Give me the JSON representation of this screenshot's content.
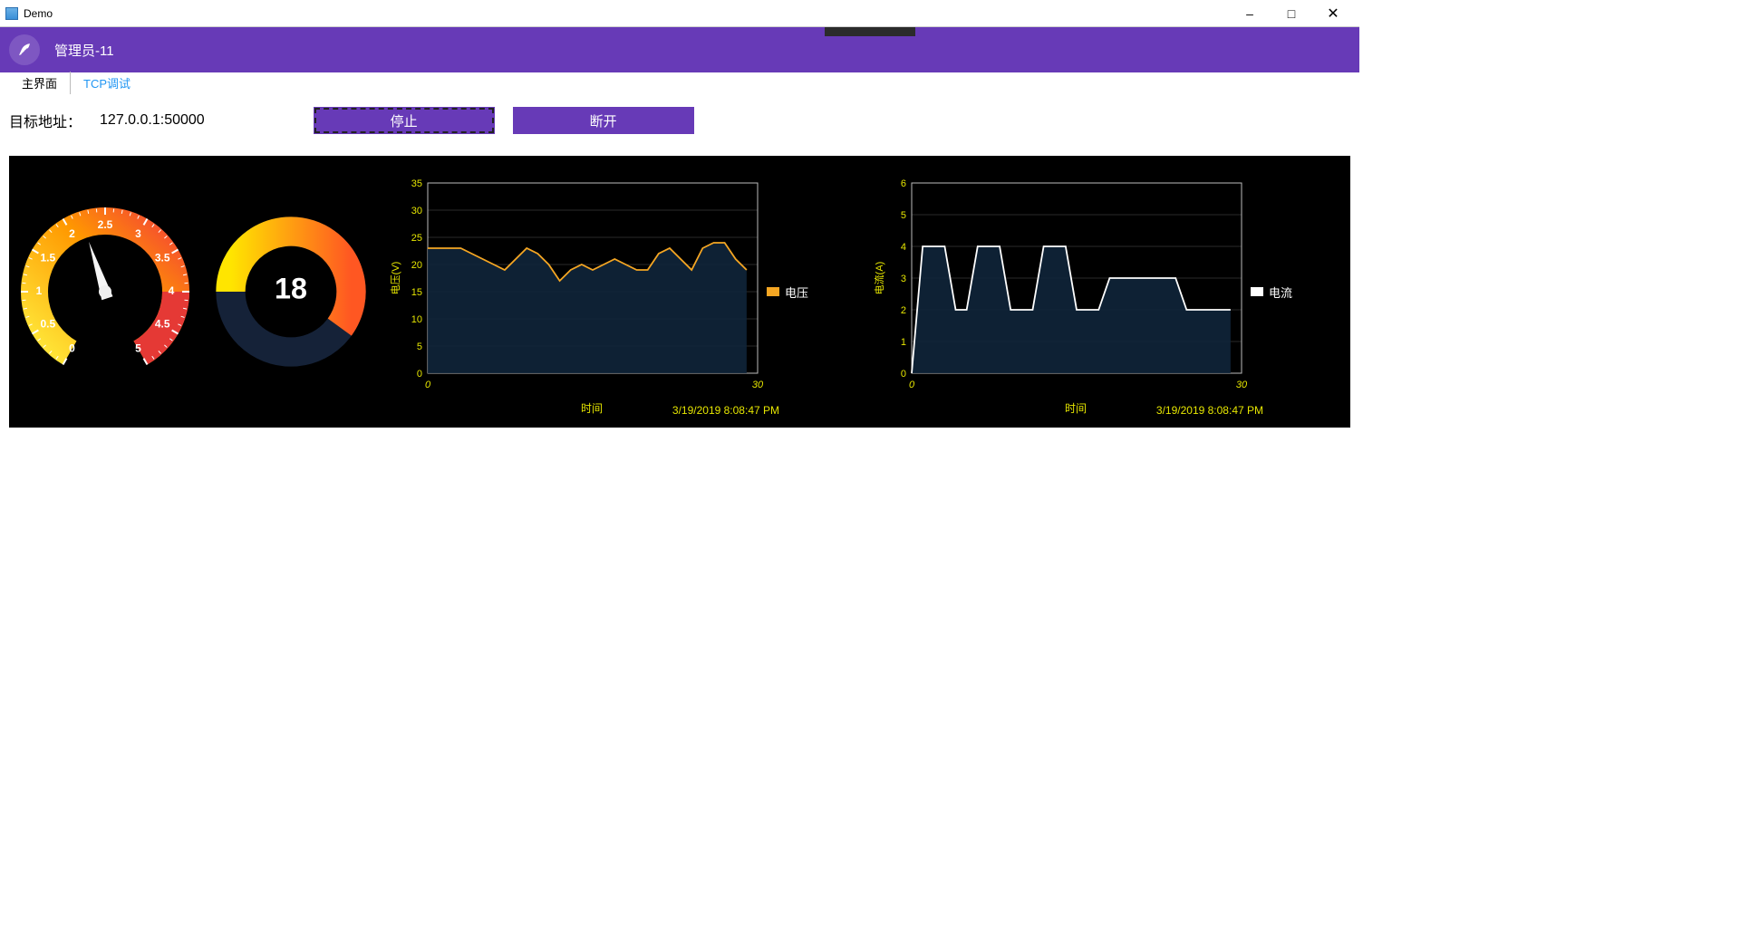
{
  "window": {
    "title": "Demo"
  },
  "header": {
    "user": "管理员-11"
  },
  "tabs": [
    {
      "label": "主界面",
      "active": true
    },
    {
      "label": "TCP调试",
      "active": false
    }
  ],
  "target": {
    "label": "目标地址：",
    "value": "127.0.0.1:50000"
  },
  "buttons": {
    "stop": "停止",
    "disconnect": "断开"
  },
  "gauge1": {
    "min": 0,
    "max": 5,
    "major_step": 0.5,
    "value": 2.2,
    "red_from": 4,
    "red_to": 5,
    "ticks": [
      "0",
      "0.5",
      "1",
      "1.5",
      "2",
      "2.5",
      "3",
      "3.5",
      "4",
      "4.5",
      "5"
    ]
  },
  "gauge2": {
    "min": 0,
    "max": 30,
    "value": 18,
    "display": "18"
  },
  "legend": {
    "voltage": "电压",
    "current": "电流"
  },
  "timestamp": "3/19/2019 8:08:47 PM",
  "xlabel": "时间",
  "chart_data": [
    {
      "type": "area",
      "title": "",
      "ylabel": "电压(V)",
      "xlabel": "时间",
      "xlim": [
        0,
        30
      ],
      "ylim": [
        0,
        35
      ],
      "yticks": [
        0,
        5,
        10,
        15,
        20,
        25,
        30,
        35
      ],
      "series": [
        {
          "name": "电压",
          "color": "#F5A623",
          "x": [
            0,
            1,
            2,
            3,
            4,
            5,
            6,
            7,
            8,
            9,
            10,
            11,
            12,
            13,
            14,
            15,
            16,
            17,
            18,
            19,
            20,
            21,
            22,
            23,
            24,
            25,
            26,
            27,
            28,
            29
          ],
          "values": [
            23,
            23,
            23,
            23,
            22,
            21,
            20,
            19,
            21,
            23,
            22,
            20,
            17,
            19,
            20,
            19,
            20,
            21,
            20,
            19,
            19,
            22,
            23,
            21,
            19,
            23,
            24,
            24,
            21,
            19
          ]
        }
      ]
    },
    {
      "type": "area",
      "title": "",
      "ylabel": "电流(A)",
      "xlabel": "时间",
      "xlim": [
        0,
        30
      ],
      "ylim": [
        0,
        6
      ],
      "yticks": [
        0,
        1,
        2,
        3,
        4,
        5,
        6
      ],
      "series": [
        {
          "name": "电流",
          "color": "#ffffff",
          "x": [
            0,
            1,
            2,
            3,
            4,
            5,
            6,
            7,
            8,
            9,
            10,
            11,
            12,
            13,
            14,
            15,
            16,
            17,
            18,
            19,
            20,
            21,
            22,
            23,
            24,
            25,
            26,
            27,
            28,
            29
          ],
          "values": [
            0,
            4,
            4,
            4,
            2,
            2,
            4,
            4,
            4,
            2,
            2,
            2,
            4,
            4,
            4,
            2,
            2,
            2,
            3,
            3,
            3,
            3,
            3,
            3,
            3,
            2,
            2,
            2,
            2,
            2
          ]
        }
      ]
    }
  ]
}
